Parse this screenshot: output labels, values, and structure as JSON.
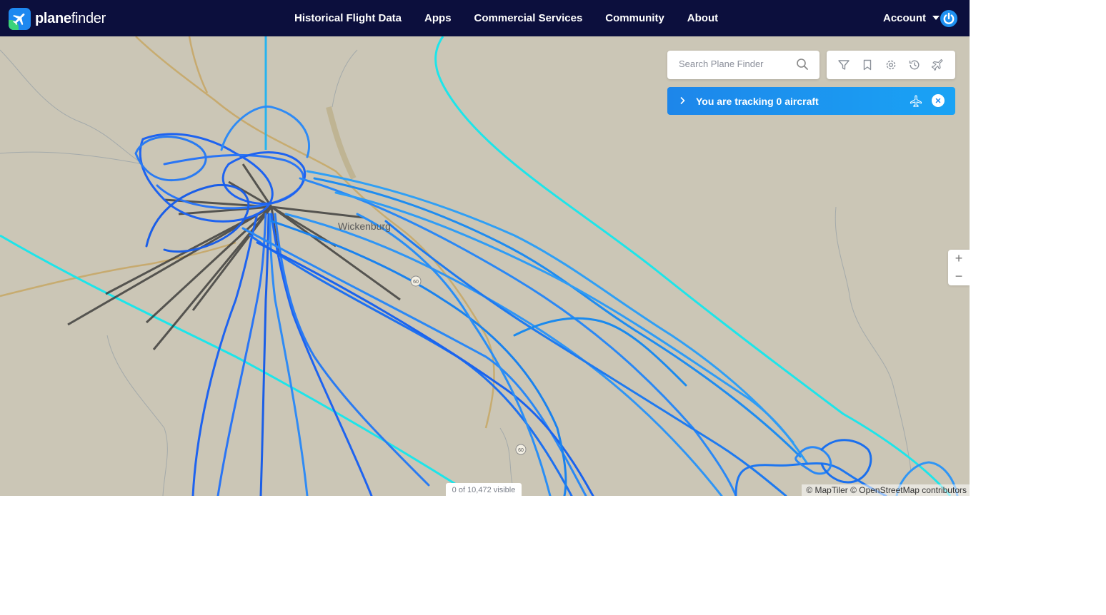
{
  "brand": {
    "name_bold": "plane",
    "name_light": "finder"
  },
  "nav": {
    "items": [
      {
        "label": "Historical Flight Data"
      },
      {
        "label": "Apps"
      },
      {
        "label": "Commercial Services"
      },
      {
        "label": "Community"
      },
      {
        "label": "About"
      }
    ],
    "account_label": "Account"
  },
  "search": {
    "placeholder": "Search Plane Finder"
  },
  "toolbar": {
    "icons": [
      "filter-icon",
      "bookmark-icon",
      "settings-icon",
      "history-icon",
      "playback-icon"
    ]
  },
  "tracking": {
    "text": "You are tracking 0 aircraft"
  },
  "map": {
    "town_label": "Wickenburg",
    "road_shield": "60",
    "visible_count": "0 of 10,472 visible",
    "attribution": "© MapTiler © OpenStreetMap contributors",
    "zoom_in": "+",
    "zoom_out": "−"
  },
  "colors": {
    "nav_bg": "#0c0f3d",
    "accent": "#1e88f0",
    "map_land": "#cbc6b6",
    "track_blue": "#1a6af0",
    "track_cyan": "#1ef0e8"
  }
}
